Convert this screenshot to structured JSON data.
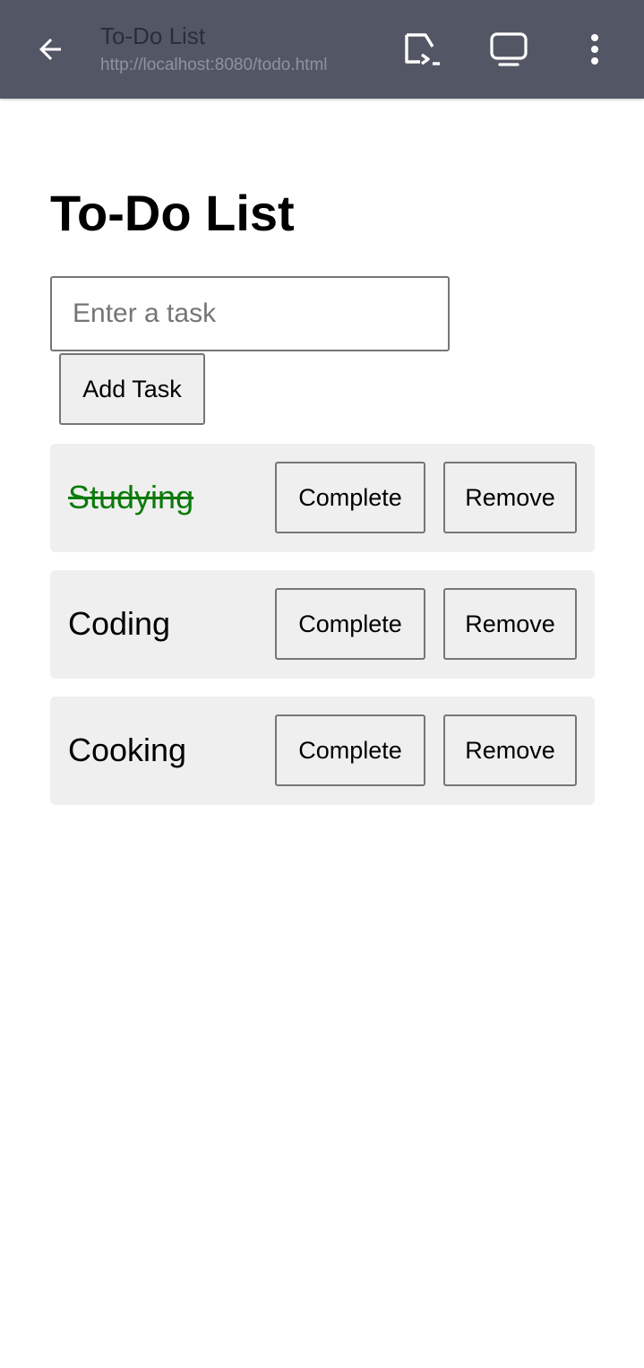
{
  "app_bar": {
    "title": "To-Do List",
    "url": "http://localhost:8080/todo.html",
    "icons": [
      "back-arrow-icon",
      "open-in-external-icon",
      "desktop-mode-icon",
      "more-vert-icon"
    ],
    "background": "#535765"
  },
  "page": {
    "heading": "To-Do List",
    "input": {
      "value": "",
      "placeholder": "Enter a task"
    },
    "add_button_label": "Add Task"
  },
  "tasks": [
    {
      "label": "Studying",
      "completed": true,
      "complete_label": "Complete",
      "remove_label": "Remove"
    },
    {
      "label": "Coding",
      "completed": false,
      "complete_label": "Complete",
      "remove_label": "Remove"
    },
    {
      "label": "Cooking",
      "completed": false,
      "complete_label": "Complete",
      "remove_label": "Remove"
    }
  ],
  "colors": {
    "completed_text": "#0a7a0a",
    "task_background": "#efefef"
  }
}
